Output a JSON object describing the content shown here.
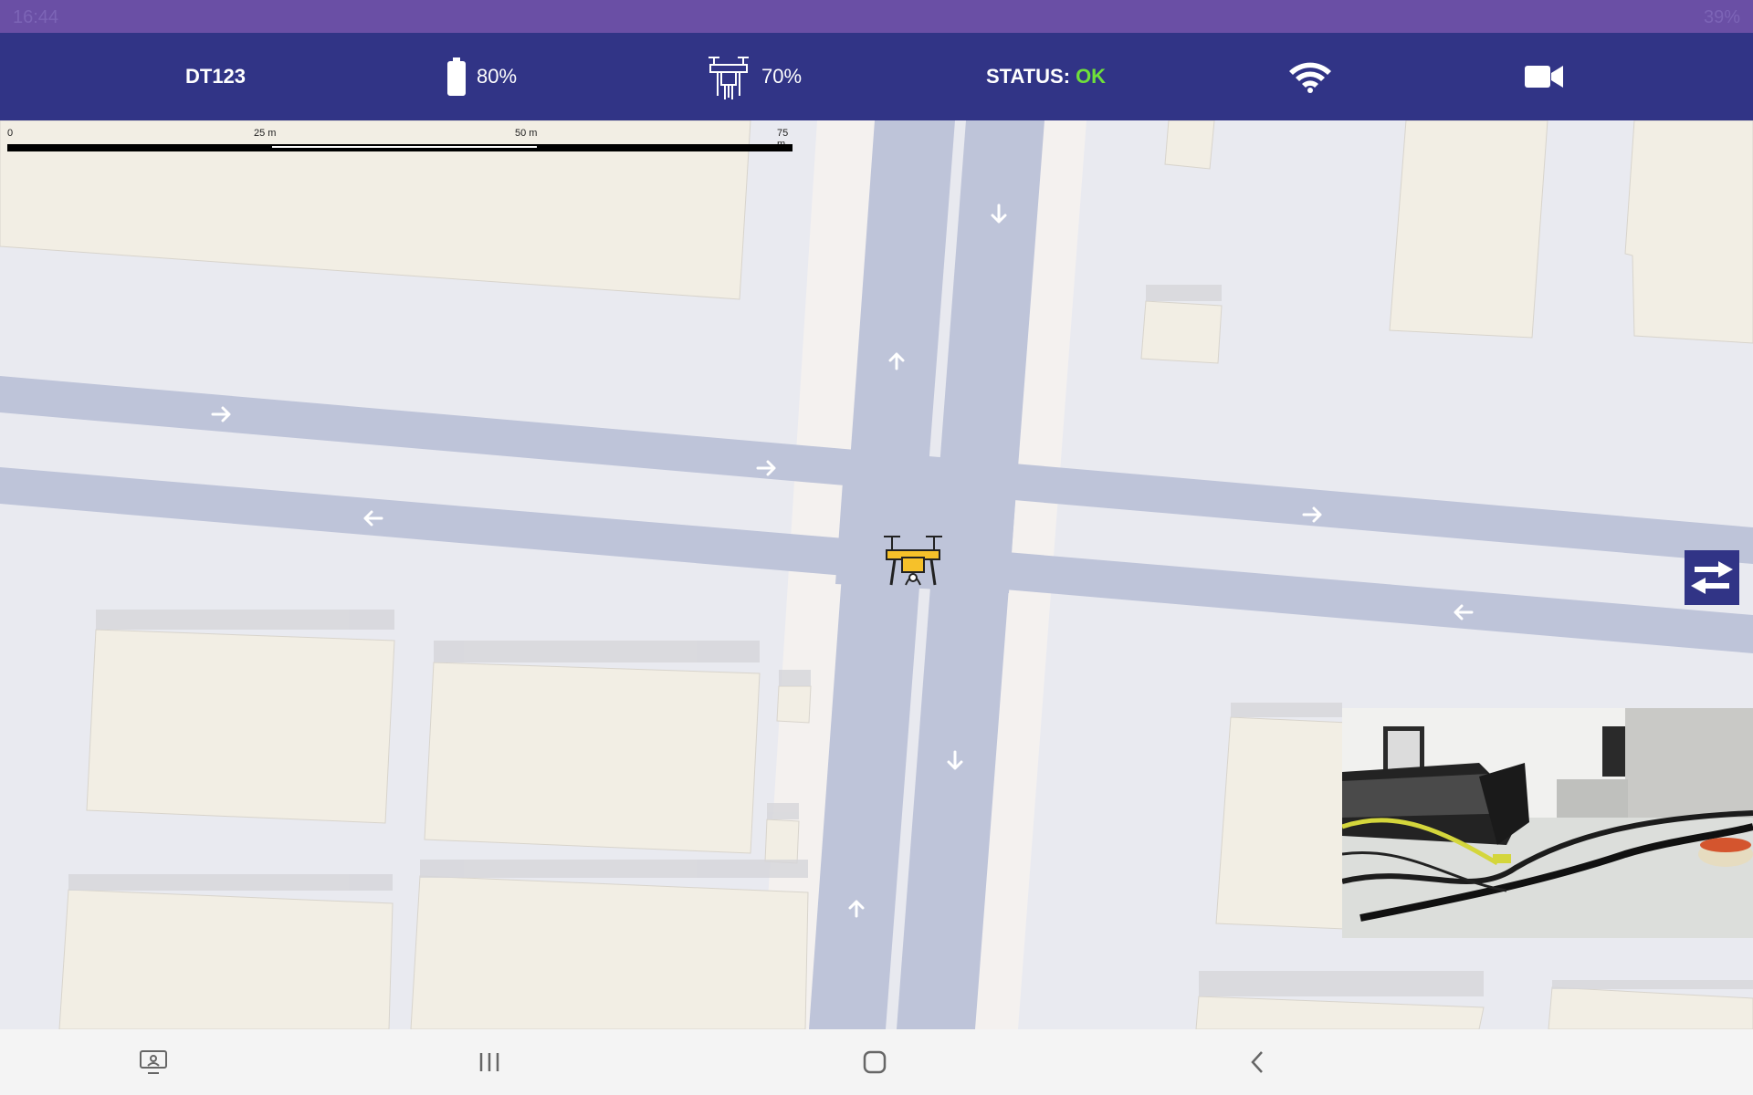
{
  "statusbar": {
    "time": "16:44",
    "battery": "39%"
  },
  "topbar": {
    "drone_id": "DT123",
    "battery_percent": "80%",
    "battery_icon": "battery-icon",
    "drone_signal_percent": "70%",
    "drone_icon": "drone-icon",
    "status_label": "STATUS:",
    "status_value": "OK",
    "wifi_icon": "wifi-icon",
    "camera_icon": "video-camera-icon",
    "colors": {
      "bar": "#313486",
      "ok": "#6fe03a"
    }
  },
  "map": {
    "scale": {
      "ticks": [
        "0",
        "25 m",
        "50 m",
        "75 m"
      ]
    },
    "drone_marker_icon": "drone-marker-icon",
    "arrow_icon": "arrow-icon"
  },
  "controls": {
    "swap_icon": "swap-arrows-icon"
  },
  "video_feed": {
    "description_icon": "camera-feed"
  },
  "navbar": {
    "recent_apps_icon": "recent-apps-icon",
    "home_icon": "home-icon",
    "back_icon": "back-icon",
    "screen_icon": "screen-mirror-icon"
  }
}
